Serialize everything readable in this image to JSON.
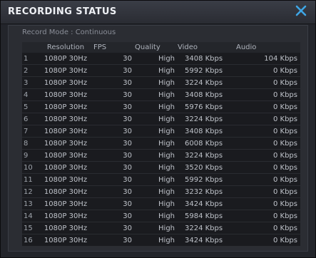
{
  "window": {
    "title": "RECORDING STATUS",
    "close_icon": "close-icon"
  },
  "record_mode": "Record Mode : Continuous",
  "table": {
    "columns": [
      "",
      "Resolution",
      "FPS",
      "Quality",
      "Video",
      "Audio"
    ],
    "rows": [
      [
        "1",
        "1080P 30Hz",
        "30",
        "High",
        "3408 Kbps",
        "104 Kbps"
      ],
      [
        "2",
        "1080P 30Hz",
        "30",
        "High",
        "5992 Kbps",
        "0 Kbps"
      ],
      [
        "3",
        "1080P 30Hz",
        "30",
        "High",
        "3224 Kbps",
        "0 Kbps"
      ],
      [
        "4",
        "1080P 30Hz",
        "30",
        "High",
        "3408 Kbps",
        "0 Kbps"
      ],
      [
        "5",
        "1080P 30Hz",
        "30",
        "High",
        "5976 Kbps",
        "0 Kbps"
      ],
      [
        "6",
        "1080P 30Hz",
        "30",
        "High",
        "3224 Kbps",
        "0 Kbps"
      ],
      [
        "7",
        "1080P 30Hz",
        "30",
        "High",
        "3408 Kbps",
        "0 Kbps"
      ],
      [
        "8",
        "1080P 30Hz",
        "30",
        "High",
        "6008 Kbps",
        "0 Kbps"
      ],
      [
        "9",
        "1080P 30Hz",
        "30",
        "High",
        "3224 Kbps",
        "0 Kbps"
      ],
      [
        "10",
        "1080P 30Hz",
        "30",
        "High",
        "3520 Kbps",
        "0 Kbps"
      ],
      [
        "11",
        "1080P 30Hz",
        "30",
        "High",
        "5992 Kbps",
        "0 Kbps"
      ],
      [
        "12",
        "1080P 30Hz",
        "30",
        "High",
        "3232 Kbps",
        "0 Kbps"
      ],
      [
        "13",
        "1080P 30Hz",
        "30",
        "High",
        "3424 Kbps",
        "0 Kbps"
      ],
      [
        "14",
        "1080P 30Hz",
        "30",
        "High",
        "5984 Kbps",
        "0 Kbps"
      ],
      [
        "15",
        "1080P 30Hz",
        "30",
        "High",
        "3224 Kbps",
        "0 Kbps"
      ],
      [
        "16",
        "1080P 30Hz",
        "30",
        "High",
        "3424 Kbps",
        "0 Kbps"
      ]
    ]
  },
  "colors": {
    "accent_close": "#3ea6e6",
    "title_text": "#eef0f4",
    "row_bg": "#1a1b1f"
  }
}
